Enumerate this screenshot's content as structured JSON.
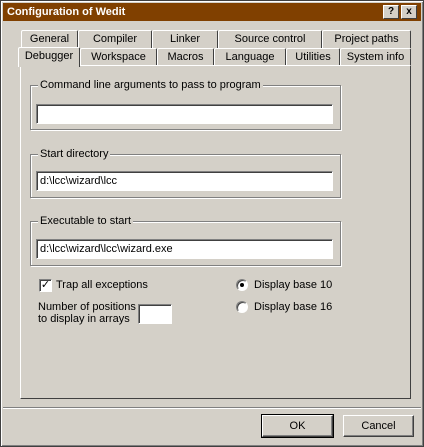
{
  "window": {
    "title": "Configuration of Wedit",
    "help_label": "?",
    "close_label": "x"
  },
  "tabs": {
    "row1": [
      {
        "label": "General"
      },
      {
        "label": "Compiler"
      },
      {
        "label": "Linker"
      },
      {
        "label": "Source control"
      },
      {
        "label": "Project paths"
      }
    ],
    "row2": [
      {
        "label": "Debugger",
        "selected": true
      },
      {
        "label": "Workspace"
      },
      {
        "label": "Macros"
      },
      {
        "label": "Language"
      },
      {
        "label": "Utilities"
      },
      {
        "label": "System info"
      }
    ]
  },
  "debugger": {
    "cmdline_group": "Command line arguments to pass to program",
    "cmdline_value": "",
    "startdir_group": "Start directory",
    "startdir_value": "d:\\lcc\\wizard\\lcc",
    "exe_group": "Executable to start",
    "exe_value": "d:\\lcc\\wizard\\lcc\\wizard.exe",
    "trap_label": "Trap all exceptions",
    "trap_checked": true,
    "check_mark": "✓",
    "positions_label_line1": "Number of positions",
    "positions_label_line2": "to display in arrays",
    "positions_value": "",
    "base10_label": "Display base 10",
    "base16_label": "Display base 16",
    "selected_base": 10
  },
  "buttons": {
    "ok_label": "OK",
    "cancel_label": "Cancel"
  },
  "colors": {
    "titlebar": "#804000",
    "face": "#d4d0c8"
  }
}
